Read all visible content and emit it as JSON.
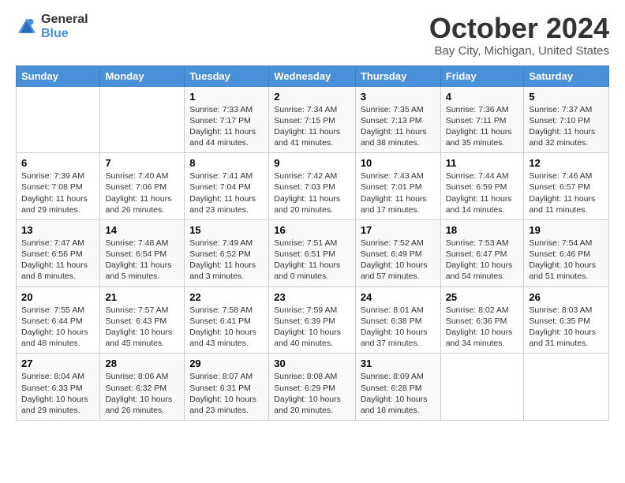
{
  "header": {
    "logo_general": "General",
    "logo_blue": "Blue",
    "title": "October 2024",
    "subtitle": "Bay City, Michigan, United States"
  },
  "weekdays": [
    "Sunday",
    "Monday",
    "Tuesday",
    "Wednesday",
    "Thursday",
    "Friday",
    "Saturday"
  ],
  "weeks": [
    [
      {
        "day": "",
        "content": ""
      },
      {
        "day": "",
        "content": ""
      },
      {
        "day": "1",
        "content": "Sunrise: 7:33 AM\nSunset: 7:17 PM\nDaylight: 11 hours and 44 minutes."
      },
      {
        "day": "2",
        "content": "Sunrise: 7:34 AM\nSunset: 7:15 PM\nDaylight: 11 hours and 41 minutes."
      },
      {
        "day": "3",
        "content": "Sunrise: 7:35 AM\nSunset: 7:13 PM\nDaylight: 11 hours and 38 minutes."
      },
      {
        "day": "4",
        "content": "Sunrise: 7:36 AM\nSunset: 7:11 PM\nDaylight: 11 hours and 35 minutes."
      },
      {
        "day": "5",
        "content": "Sunrise: 7:37 AM\nSunset: 7:10 PM\nDaylight: 11 hours and 32 minutes."
      }
    ],
    [
      {
        "day": "6",
        "content": "Sunrise: 7:39 AM\nSunset: 7:08 PM\nDaylight: 11 hours and 29 minutes."
      },
      {
        "day": "7",
        "content": "Sunrise: 7:40 AM\nSunset: 7:06 PM\nDaylight: 11 hours and 26 minutes."
      },
      {
        "day": "8",
        "content": "Sunrise: 7:41 AM\nSunset: 7:04 PM\nDaylight: 11 hours and 23 minutes."
      },
      {
        "day": "9",
        "content": "Sunrise: 7:42 AM\nSunset: 7:03 PM\nDaylight: 11 hours and 20 minutes."
      },
      {
        "day": "10",
        "content": "Sunrise: 7:43 AM\nSunset: 7:01 PM\nDaylight: 11 hours and 17 minutes."
      },
      {
        "day": "11",
        "content": "Sunrise: 7:44 AM\nSunset: 6:59 PM\nDaylight: 11 hours and 14 minutes."
      },
      {
        "day": "12",
        "content": "Sunrise: 7:46 AM\nSunset: 6:57 PM\nDaylight: 11 hours and 11 minutes."
      }
    ],
    [
      {
        "day": "13",
        "content": "Sunrise: 7:47 AM\nSunset: 6:56 PM\nDaylight: 11 hours and 8 minutes."
      },
      {
        "day": "14",
        "content": "Sunrise: 7:48 AM\nSunset: 6:54 PM\nDaylight: 11 hours and 5 minutes."
      },
      {
        "day": "15",
        "content": "Sunrise: 7:49 AM\nSunset: 6:52 PM\nDaylight: 11 hours and 3 minutes."
      },
      {
        "day": "16",
        "content": "Sunrise: 7:51 AM\nSunset: 6:51 PM\nDaylight: 11 hours and 0 minutes."
      },
      {
        "day": "17",
        "content": "Sunrise: 7:52 AM\nSunset: 6:49 PM\nDaylight: 10 hours and 57 minutes."
      },
      {
        "day": "18",
        "content": "Sunrise: 7:53 AM\nSunset: 6:47 PM\nDaylight: 10 hours and 54 minutes."
      },
      {
        "day": "19",
        "content": "Sunrise: 7:54 AM\nSunset: 6:46 PM\nDaylight: 10 hours and 51 minutes."
      }
    ],
    [
      {
        "day": "20",
        "content": "Sunrise: 7:55 AM\nSunset: 6:44 PM\nDaylight: 10 hours and 48 minutes."
      },
      {
        "day": "21",
        "content": "Sunrise: 7:57 AM\nSunset: 6:43 PM\nDaylight: 10 hours and 45 minutes."
      },
      {
        "day": "22",
        "content": "Sunrise: 7:58 AM\nSunset: 6:41 PM\nDaylight: 10 hours and 43 minutes."
      },
      {
        "day": "23",
        "content": "Sunrise: 7:59 AM\nSunset: 6:39 PM\nDaylight: 10 hours and 40 minutes."
      },
      {
        "day": "24",
        "content": "Sunrise: 8:01 AM\nSunset: 6:38 PM\nDaylight: 10 hours and 37 minutes."
      },
      {
        "day": "25",
        "content": "Sunrise: 8:02 AM\nSunset: 6:36 PM\nDaylight: 10 hours and 34 minutes."
      },
      {
        "day": "26",
        "content": "Sunrise: 8:03 AM\nSunset: 6:35 PM\nDaylight: 10 hours and 31 minutes."
      }
    ],
    [
      {
        "day": "27",
        "content": "Sunrise: 8:04 AM\nSunset: 6:33 PM\nDaylight: 10 hours and 29 minutes."
      },
      {
        "day": "28",
        "content": "Sunrise: 8:06 AM\nSunset: 6:32 PM\nDaylight: 10 hours and 26 minutes."
      },
      {
        "day": "29",
        "content": "Sunrise: 8:07 AM\nSunset: 6:31 PM\nDaylight: 10 hours and 23 minutes."
      },
      {
        "day": "30",
        "content": "Sunrise: 8:08 AM\nSunset: 6:29 PM\nDaylight: 10 hours and 20 minutes."
      },
      {
        "day": "31",
        "content": "Sunrise: 8:09 AM\nSunset: 6:28 PM\nDaylight: 10 hours and 18 minutes."
      },
      {
        "day": "",
        "content": ""
      },
      {
        "day": "",
        "content": ""
      }
    ]
  ]
}
